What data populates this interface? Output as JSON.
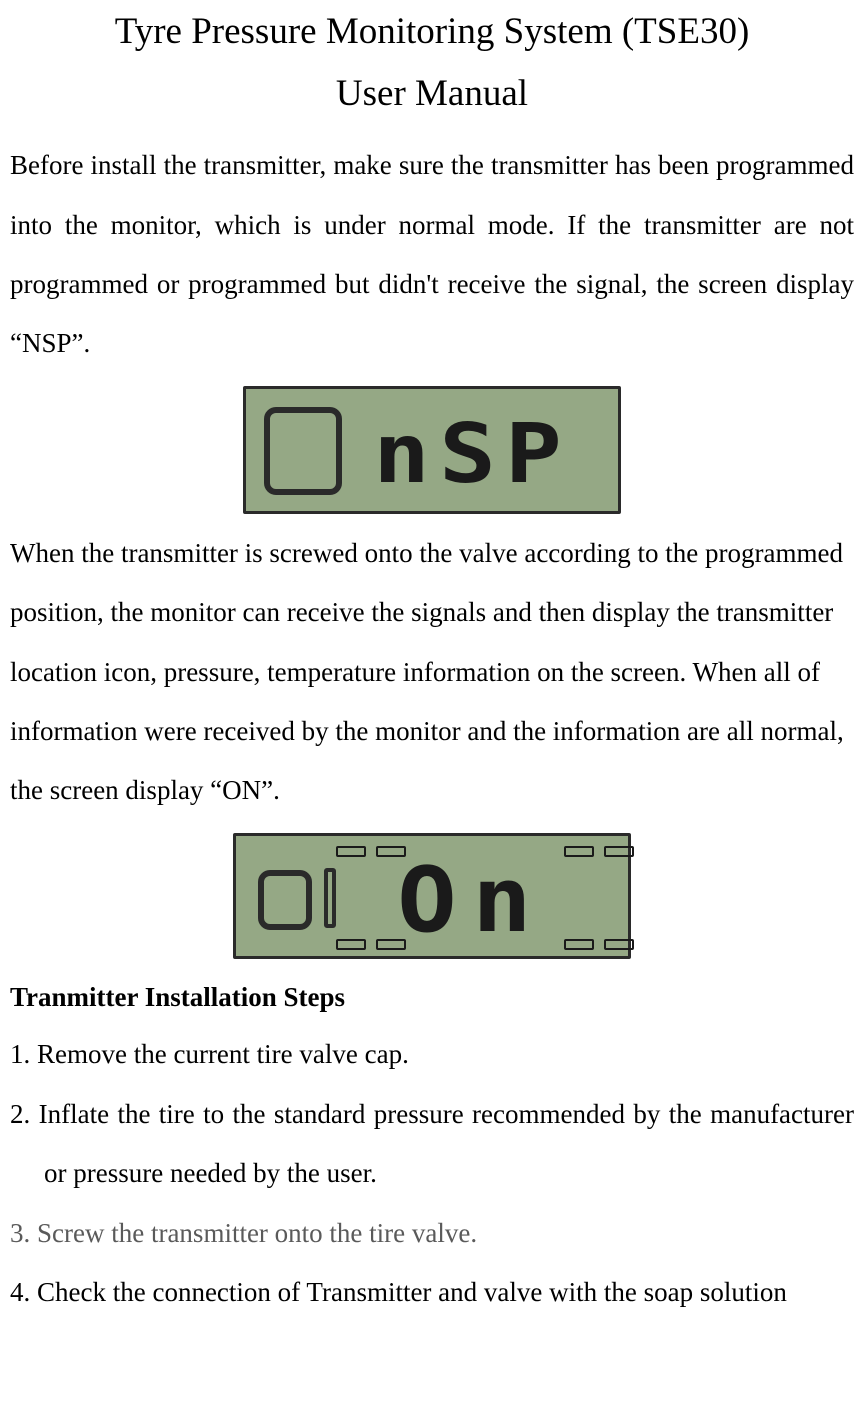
{
  "title": "Tyre Pressure Monitoring System (TSE30)",
  "subtitle": "User Manual",
  "para1": "Before install the transmitter, make sure the transmitter has been programmed into the monitor, which is under normal mode. If the transmitter are not programmed or programmed but didn't receive the signal, the screen display “NSP”.",
  "lcd1_text": "nSP",
  "para2": "When the transmitter is screwed onto the valve according to the programmed position, the monitor can receive the signals and then display the transmitter location icon, pressure, temperature information on the screen. When all of information were received by the monitor and the information are all normal, the screen display “ON”.",
  "lcd2_text": "On",
  "section_heading": "Tranmitter Installation Steps",
  "steps": {
    "s1": "1. Remove the current tire valve cap.",
    "s2": "2. Inflate the tire to the standard pressure recommended by the manufacturer or pressure needed by the user.",
    "s3": "3. Screw the transmitter onto the tire valve.",
    "s4": "4. Check the connection of Transmitter and valve with the soap solution"
  }
}
